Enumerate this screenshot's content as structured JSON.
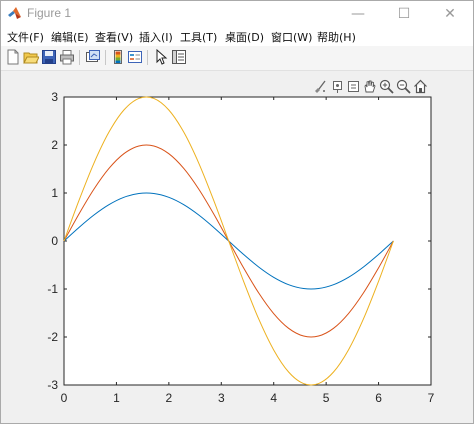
{
  "window": {
    "title": "Figure 1",
    "controls": {
      "minimize": "—",
      "maximize": "☐",
      "close": "✕"
    }
  },
  "menu": [
    {
      "label": "文件(F)"
    },
    {
      "label": "编辑(E)"
    },
    {
      "label": "查看(V)"
    },
    {
      "label": "插入(I)"
    },
    {
      "label": "工具(T)"
    },
    {
      "label": "桌面(D)"
    },
    {
      "label": "窗口(W)"
    },
    {
      "label": "帮助(H)"
    }
  ],
  "toolbar": {
    "buttons": [
      "new-figure-icon",
      "open-file-icon",
      "save-icon",
      "print-icon",
      "link-plot-icon",
      "insert-colorbar-icon",
      "insert-legend-icon",
      "edit-plot-icon",
      "property-inspector-icon"
    ]
  },
  "axes_toolbar": {
    "buttons": [
      "brush-icon",
      "data-tips-icon",
      "export-icon",
      "pan-icon",
      "zoom-in-icon",
      "zoom-out-icon",
      "home-icon"
    ]
  },
  "colors": {
    "series1": "#0072bd",
    "series2": "#d95319",
    "series3": "#edb120",
    "axes_bg": "#ffffff",
    "figure_bg": "#f0f0f0"
  },
  "chart_data": {
    "type": "line",
    "title": "",
    "xlabel": "",
    "ylabel": "",
    "xlim": [
      0,
      7
    ],
    "ylim": [
      -3,
      3
    ],
    "xticks": [
      "0",
      "1",
      "2",
      "3",
      "4",
      "5",
      "6",
      "7"
    ],
    "yticks": [
      "-3",
      "-2",
      "-1",
      "0",
      "1",
      "2",
      "3"
    ],
    "grid": false,
    "x": [
      0,
      0.2856,
      0.5712,
      0.8568,
      1.1424,
      1.428,
      1.7136,
      1.9992,
      2.2848,
      2.5704,
      2.856,
      3.1416,
      3.4272,
      3.7128,
      3.9984,
      4.284,
      4.5696,
      4.8552,
      5.1408,
      5.4264,
      5.712,
      5.9976,
      6.2832
    ],
    "series": [
      {
        "values": [
          0,
          0.282,
          0.541,
          0.756,
          0.91,
          0.99,
          0.99,
          0.91,
          0.756,
          0.541,
          0.282,
          0,
          -0.282,
          -0.541,
          -0.756,
          -0.91,
          -0.99,
          -0.99,
          -0.91,
          -0.756,
          -0.541,
          -0.282,
          0
        ]
      },
      {
        "values": [
          0,
          0.563,
          1.081,
          1.511,
          1.819,
          1.98,
          1.98,
          1.819,
          1.511,
          1.081,
          0.563,
          0,
          -0.563,
          -1.081,
          -1.511,
          -1.819,
          -1.98,
          -1.98,
          -1.819,
          -1.511,
          -1.081,
          -0.563,
          0
        ]
      },
      {
        "values": [
          0,
          0.845,
          1.622,
          2.267,
          2.729,
          2.97,
          2.97,
          2.729,
          2.267,
          1.622,
          0.845,
          0,
          -0.845,
          -1.622,
          -2.267,
          -2.729,
          -2.97,
          -2.97,
          -2.729,
          -2.267,
          -1.622,
          -0.845,
          0
        ]
      }
    ]
  }
}
